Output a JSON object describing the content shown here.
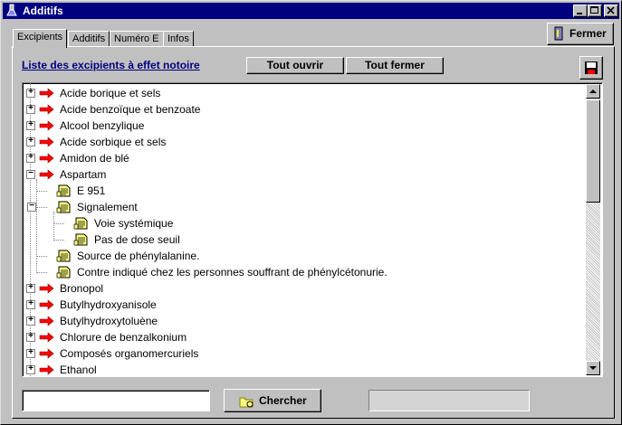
{
  "window": {
    "title": "Additifs"
  },
  "tabs": [
    {
      "label": "Excipients",
      "active": true
    },
    {
      "label": "Additifs"
    },
    {
      "label": "Numéro E"
    },
    {
      "label": "Infos"
    }
  ],
  "toolbar": {
    "close_label": "Fermer",
    "heading": "Liste des excipients à effet notoire",
    "expand_all_label": "Tout ouvrir",
    "collapse_all_label": "Tout fermer"
  },
  "tree": {
    "items": [
      {
        "label": "Acide borique et sels",
        "level": 0,
        "type": "arrow",
        "expander": "+"
      },
      {
        "label": "Acide benzoïque et benzoate",
        "level": 0,
        "type": "arrow",
        "expander": "+"
      },
      {
        "label": "Alcool benzylique",
        "level": 0,
        "type": "arrow",
        "expander": "+"
      },
      {
        "label": "Acide sorbique et sels",
        "level": 0,
        "type": "arrow",
        "expander": "+"
      },
      {
        "label": "Amidon de blé",
        "level": 0,
        "type": "arrow",
        "expander": "+"
      },
      {
        "label": "Aspartam",
        "level": 0,
        "type": "arrow",
        "expander": "-"
      },
      {
        "label": "E 951",
        "level": 1,
        "type": "doc",
        "expander": ""
      },
      {
        "label": "Signalement",
        "level": 1,
        "type": "doc",
        "expander": "-"
      },
      {
        "label": "Voie systémique",
        "level": 2,
        "type": "doc",
        "expander": ""
      },
      {
        "label": "Pas de dose seuil",
        "level": 2,
        "type": "doc",
        "expander": ""
      },
      {
        "label": "Source de phénylalanine.",
        "level": 1,
        "type": "doc",
        "expander": ""
      },
      {
        "label": "Contre indiqué chez les personnes souffrant de phénylcétonurie.",
        "level": 1,
        "type": "doc",
        "expander": ""
      },
      {
        "label": "Bronopol",
        "level": 0,
        "type": "arrow",
        "expander": "+"
      },
      {
        "label": "Butylhydroxyanisole",
        "level": 0,
        "type": "arrow",
        "expander": "+"
      },
      {
        "label": "Butylhydroxytoluène",
        "level": 0,
        "type": "arrow",
        "expander": "+"
      },
      {
        "label": "Chlorure de benzalkonium",
        "level": 0,
        "type": "arrow",
        "expander": "+"
      },
      {
        "label": "Composés organomercuriels",
        "level": 0,
        "type": "arrow",
        "expander": "+"
      },
      {
        "label": "Ethanol",
        "level": 0,
        "type": "arrow",
        "expander": "+"
      }
    ]
  },
  "search": {
    "value": "",
    "button_label": "Chercher"
  },
  "icons": {
    "app": "flask-icon",
    "close_button": "exit-icon",
    "save": "floppy-disk-icon",
    "arrow": "red-arrow-icon",
    "doc": "document-icon",
    "search": "search-folder-icon"
  },
  "colors": {
    "titlebar": "#000080",
    "arrow": "#ff0000",
    "link": "#000080"
  }
}
